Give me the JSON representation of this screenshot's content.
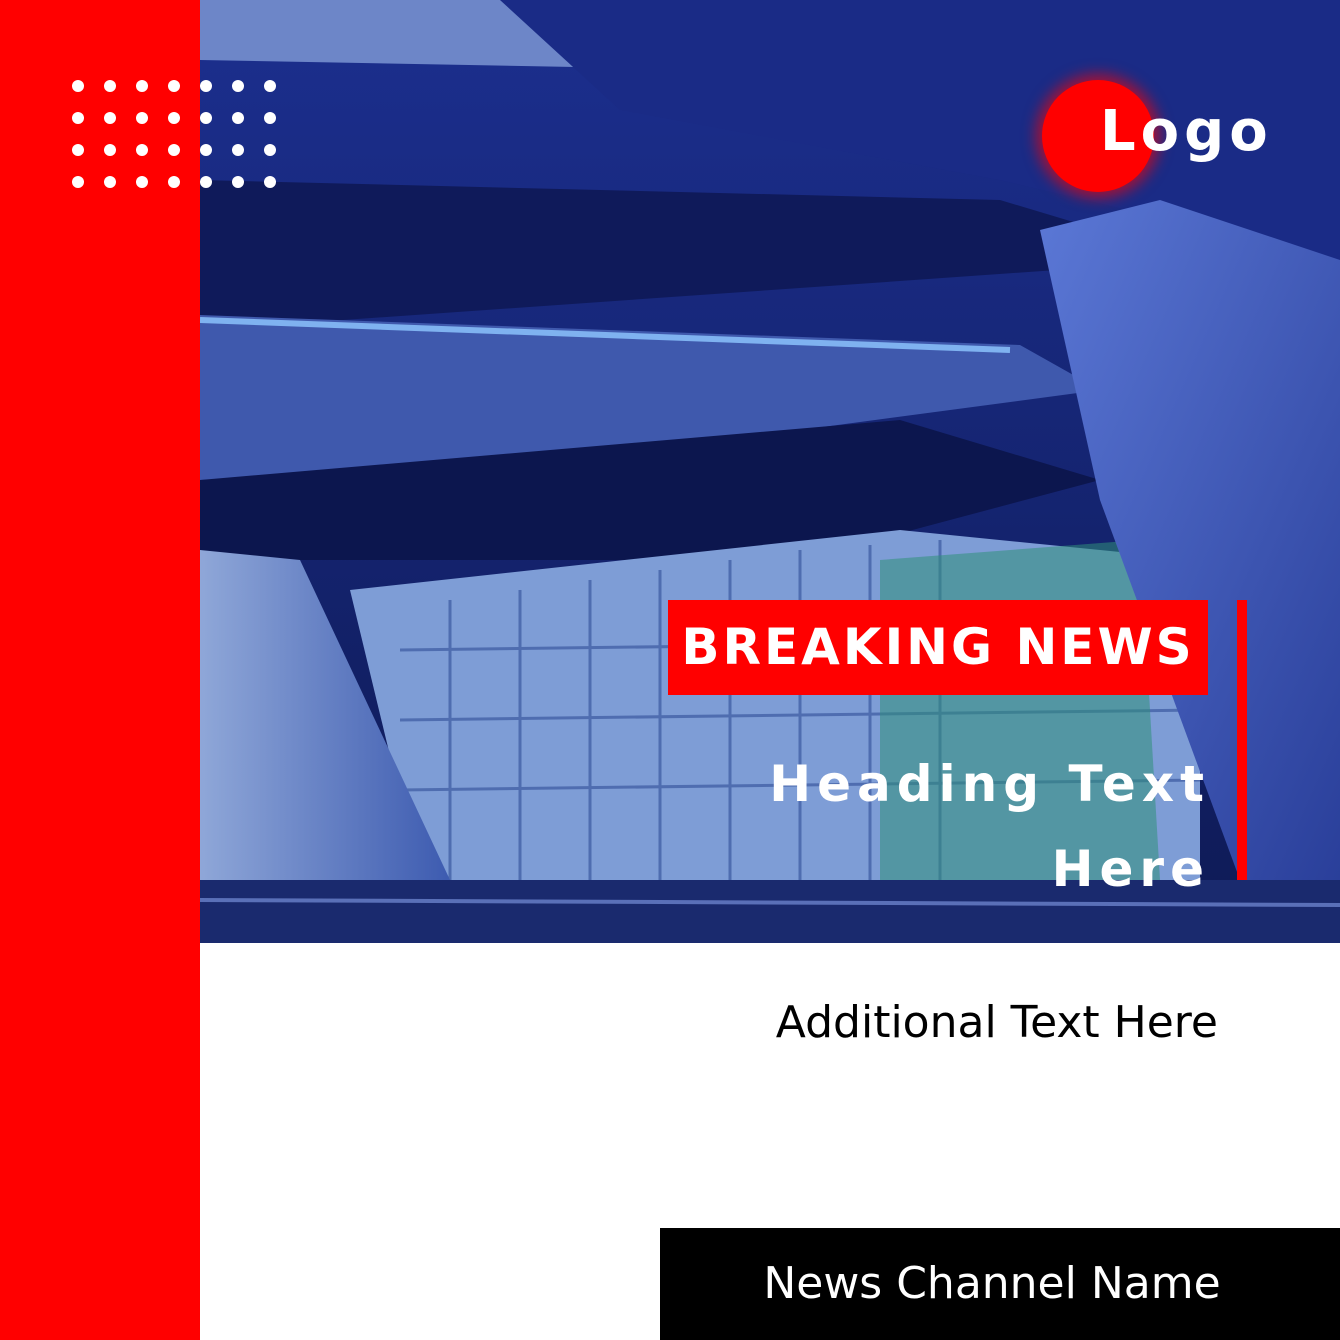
{
  "logo": {
    "text": "Logo"
  },
  "banner": {
    "label": "BREAKING NEWS"
  },
  "heading": {
    "line1": "Heading Text",
    "line2": "Here"
  },
  "additional": {
    "text": "Additional Text Here"
  },
  "footer": {
    "channel_name": "News Channel Name"
  },
  "colors": {
    "accent": "#ff0000",
    "dark": "#000000",
    "text_light": "#ffffff"
  }
}
